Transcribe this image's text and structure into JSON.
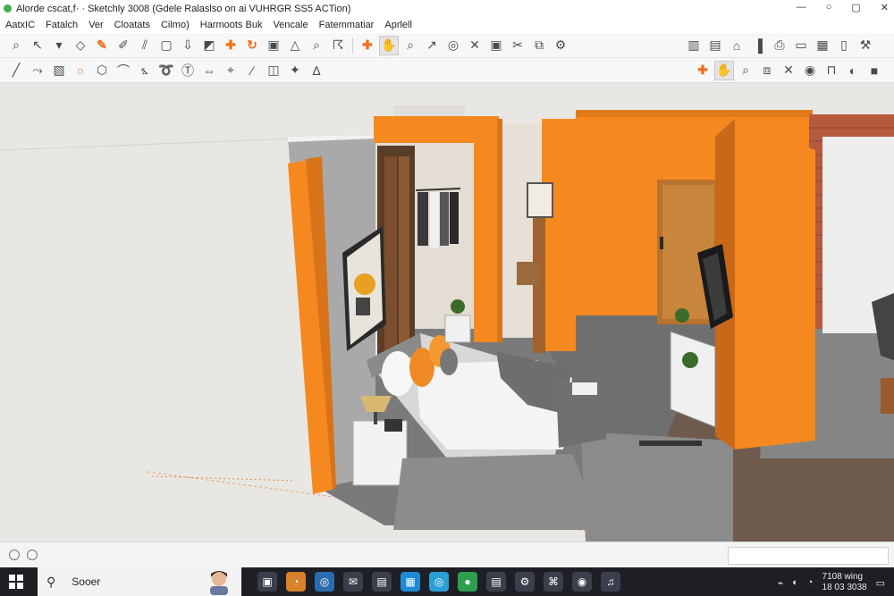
{
  "window": {
    "title": "Alorde cscat,f· · Sketchly 3008 (Gdele Ralaslso  on  ai VUHRGR SS5 ACTion)",
    "controls": [
      "—",
      "○",
      "▢",
      "✕"
    ]
  },
  "menu": {
    "items": [
      "AatxIC",
      "Fatalch",
      "Ver",
      "Cloatats",
      "Cilmo)",
      "Harmoots Buk",
      "Vencale",
      "Fatemmatiar",
      "Aprlell"
    ]
  },
  "toolbar1": {
    "left": [
      {
        "name": "search-icon",
        "glyph": "⌕"
      },
      {
        "name": "select-icon",
        "glyph": "↖"
      },
      {
        "name": "dropdown-icon",
        "glyph": "▾"
      },
      {
        "name": "eraser-icon",
        "glyph": "◇"
      },
      {
        "name": "pencil-icon",
        "glyph": "✎",
        "accent": true
      },
      {
        "name": "paint-icon",
        "glyph": "✐"
      },
      {
        "name": "hatch-icon",
        "glyph": "⫽"
      },
      {
        "name": "box-icon",
        "glyph": "▢"
      },
      {
        "name": "pushpull-icon",
        "glyph": "⇩"
      },
      {
        "name": "shapes-icon",
        "glyph": "◩"
      },
      {
        "name": "move-icon",
        "glyph": "✚",
        "accent": true
      },
      {
        "name": "rotate-icon",
        "glyph": "↻",
        "accent": true
      },
      {
        "name": "scale-icon",
        "glyph": "▣"
      },
      {
        "name": "offset-icon",
        "glyph": "△"
      },
      {
        "name": "zoom-icon",
        "glyph": "⌕"
      },
      {
        "name": "orbit-icon",
        "glyph": "☈"
      }
    ],
    "mid": [
      {
        "name": "pan-cross-icon",
        "glyph": "✚",
        "accent": true
      },
      {
        "name": "hand-icon",
        "glyph": "✋",
        "selected": true
      },
      {
        "name": "magnify-icon",
        "glyph": "⌕"
      },
      {
        "name": "measure-icon",
        "glyph": "↗"
      },
      {
        "name": "target-icon",
        "glyph": "◎"
      },
      {
        "name": "close-tool-icon",
        "glyph": "✕"
      },
      {
        "name": "camera-icon",
        "glyph": "▣"
      },
      {
        "name": "cut-icon",
        "glyph": "✂"
      },
      {
        "name": "layers-icon",
        "glyph": "⧉"
      },
      {
        "name": "settings-icon",
        "glyph": "⚙"
      }
    ],
    "right": [
      {
        "name": "component-icon",
        "glyph": "▥"
      },
      {
        "name": "page-icon",
        "glyph": "▤"
      },
      {
        "name": "house-icon",
        "glyph": "⌂"
      },
      {
        "name": "chart-icon",
        "glyph": "▐"
      },
      {
        "name": "print-icon",
        "glyph": "⎙"
      },
      {
        "name": "doc-icon",
        "glyph": "▭"
      },
      {
        "name": "folder-icon",
        "glyph": "▦"
      },
      {
        "name": "file-icon",
        "glyph": "▯"
      },
      {
        "name": "tools-icon",
        "glyph": "⚒"
      }
    ]
  },
  "toolbar2": {
    "left": [
      {
        "name": "line-icon",
        "glyph": "╱"
      },
      {
        "name": "freehand-icon",
        "glyph": "⤳"
      },
      {
        "name": "rectangle-icon",
        "glyph": "▧"
      },
      {
        "name": "circle-icon",
        "glyph": "○",
        "accent": true
      },
      {
        "name": "polygon-icon",
        "glyph": "⬡"
      },
      {
        "name": "arc-icon",
        "glyph": "⌒"
      },
      {
        "name": "protractor-icon",
        "glyph": "⦩"
      },
      {
        "name": "follow-me-icon",
        "glyph": "➰"
      },
      {
        "name": "text-icon",
        "glyph": "Ⓣ"
      },
      {
        "name": "dimension-icon",
        "glyph": "⇔"
      },
      {
        "name": "pin-icon",
        "glyph": "⌖"
      },
      {
        "name": "tape-icon",
        "glyph": "∕"
      },
      {
        "name": "section-icon",
        "glyph": "◫"
      },
      {
        "name": "axes-icon",
        "glyph": "✦"
      },
      {
        "name": "walk-icon",
        "glyph": "∆"
      }
    ],
    "right": [
      {
        "name": "orange-cross-icon",
        "glyph": "✚",
        "accent": true
      },
      {
        "name": "pan-hand-icon",
        "glyph": "✋",
        "selected": true
      },
      {
        "name": "zoom-window-icon",
        "glyph": "⌕"
      },
      {
        "name": "zoom-extents-icon",
        "glyph": "⧈"
      },
      {
        "name": "cross-tool-icon",
        "glyph": "✕"
      },
      {
        "name": "lookaround-icon",
        "glyph": "◉"
      },
      {
        "name": "stand-icon",
        "glyph": "⊓"
      },
      {
        "name": "sphere-icon",
        "glyph": "◐"
      },
      {
        "name": "stop-icon",
        "glyph": "■"
      }
    ]
  },
  "taskbar": {
    "search_label": "Sooer",
    "apps": [
      {
        "name": "photos-app-icon",
        "glyph": "▣",
        "color": "#3a3f4b"
      },
      {
        "name": "edge-app-icon",
        "glyph": "◔",
        "color": "#d9822b"
      },
      {
        "name": "browser-app-icon",
        "glyph": "◎",
        "color": "#2b6cb0"
      },
      {
        "name": "mail-app-icon",
        "glyph": "✉",
        "color": "#3a3f4b"
      },
      {
        "name": "files-app-icon",
        "glyph": "▤",
        "color": "#3a3f4b"
      },
      {
        "name": "store-app-icon",
        "glyph": "▦",
        "color": "#1f8ad6"
      },
      {
        "name": "skype-app-icon",
        "glyph": "◎",
        "color": "#2a9fd6"
      },
      {
        "name": "chrome-app-icon",
        "glyph": "●",
        "color": "#2e9e4f"
      },
      {
        "name": "notes-app-icon",
        "glyph": "▤",
        "color": "#3a3f4b"
      },
      {
        "name": "settings-app-icon",
        "glyph": "⚙",
        "color": "#3a3f4b"
      },
      {
        "name": "network-app-icon",
        "glyph": "⌘",
        "color": "#3a3f4b"
      },
      {
        "name": "maps-app-icon",
        "glyph": "◉",
        "color": "#3a3f4b"
      },
      {
        "name": "music-app-icon",
        "glyph": "♫",
        "color": "#3a3f4b"
      }
    ],
    "clock_time": "7108 wing",
    "clock_date": "18 03 3038"
  },
  "colors": {
    "orange": "#f5891f",
    "orange_dark": "#e0761a",
    "floor": "#7d7d7d",
    "wood": "#c87b3e"
  }
}
